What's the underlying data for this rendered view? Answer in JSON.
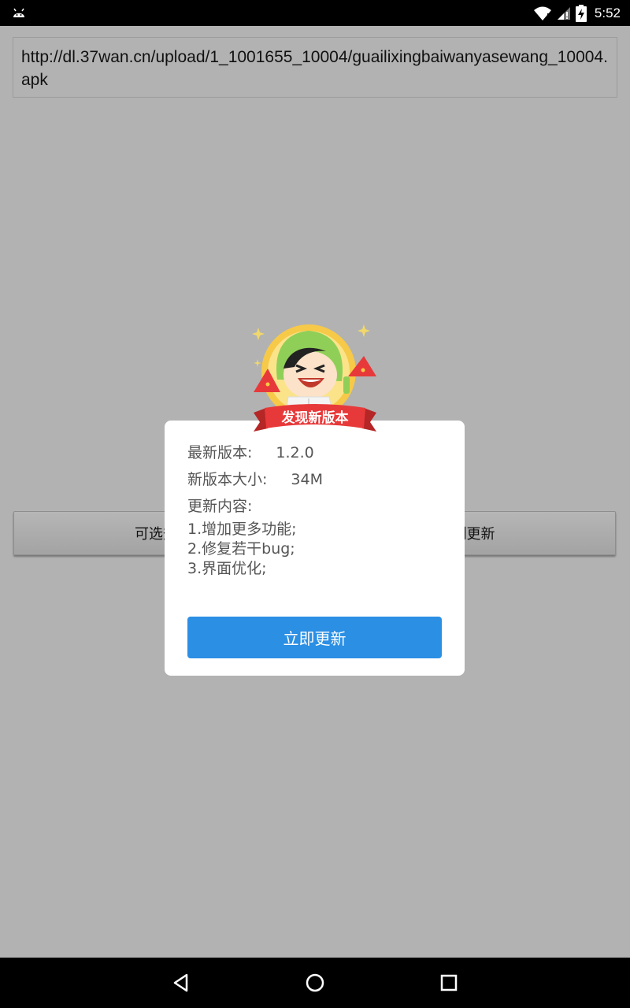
{
  "status_bar": {
    "time": "5:52",
    "icons": [
      "android-icon",
      "wifi-icon",
      "signal-icon",
      "battery-charging-icon"
    ]
  },
  "url_field": {
    "value": "http://dl.37wan.cn/upload/1_1001655_10004/guailixingbaiwanyasewang_10004.apk"
  },
  "background_buttons": {
    "left_label": "可选升级",
    "right_label": "强制更新"
  },
  "dialog": {
    "badge_text": "发现新版本",
    "version_label": "最新版本:",
    "version_value": "1.2.0",
    "size_label": "新版本大小:",
    "size_value": "34M",
    "content_label": "更新内容:",
    "changes": [
      "1.增加更多功能;",
      "2.修复若干bug;",
      "3.界面优化;"
    ],
    "update_button": "立即更新"
  },
  "nav_bar": {
    "icons": [
      "back-icon",
      "home-icon",
      "recents-icon"
    ]
  },
  "colors": {
    "status_bar": "#000000",
    "overlay_bg": "#b2b2b2",
    "button_blue": "#2b8fe4",
    "ribbon_red": "#e8393a",
    "mascot_green": "#8fcf57",
    "mascot_yellow": "#f7c948"
  }
}
